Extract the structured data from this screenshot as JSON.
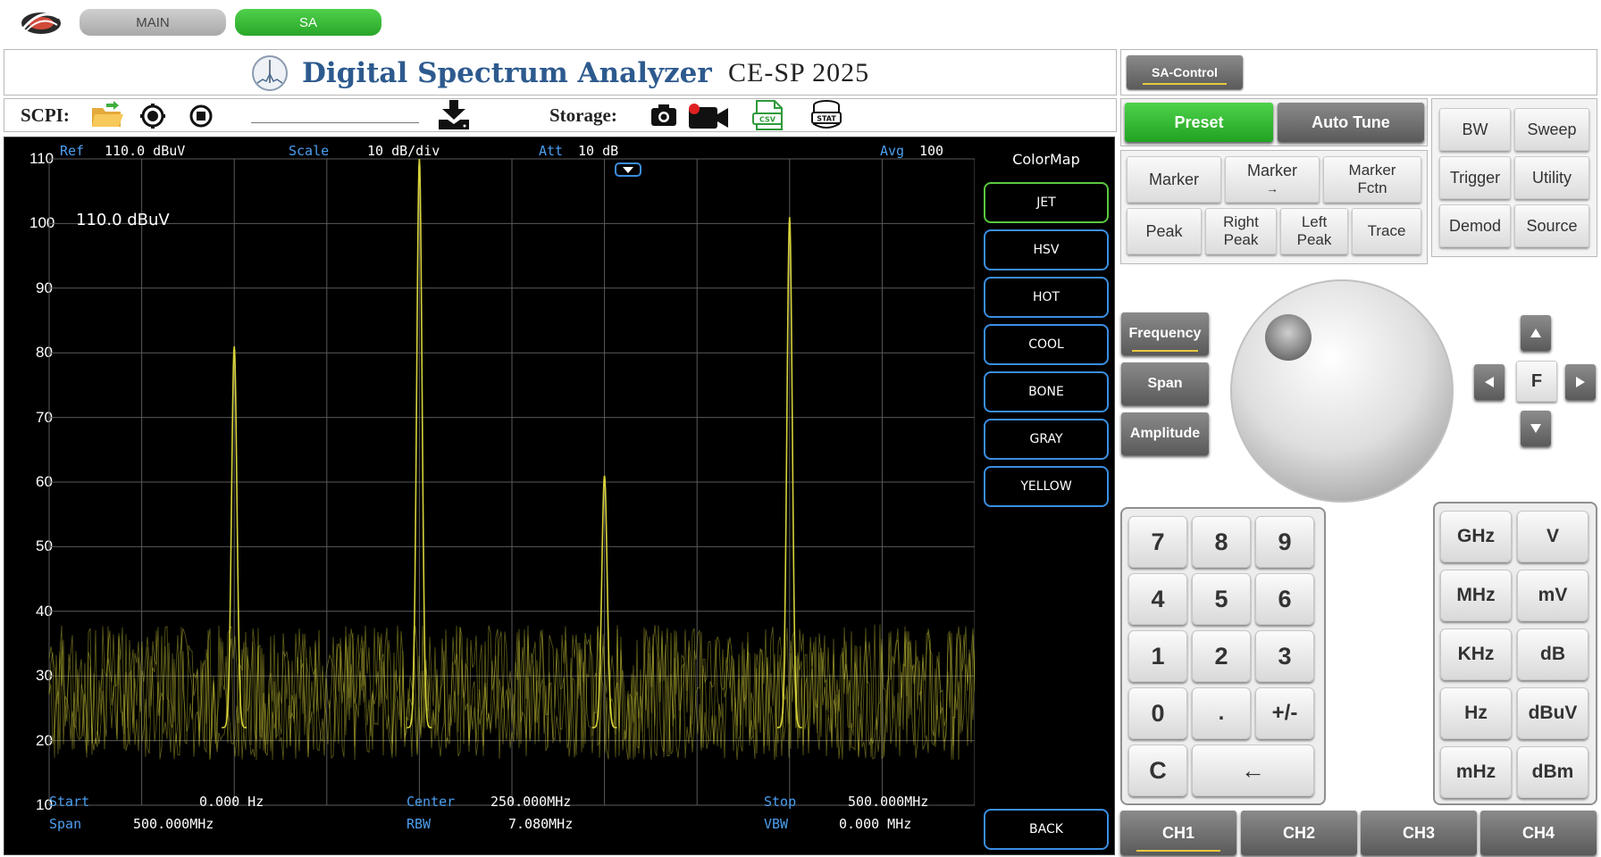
{
  "tabs": [
    {
      "label": "MAIN",
      "active": false
    },
    {
      "label": "SA",
      "active": true
    }
  ],
  "title": {
    "main": "Digital Spectrum Analyzer",
    "sub": "CE-SP  2025"
  },
  "toolbar": {
    "scpi_label": "SCPI:",
    "storage_label": "Storage:",
    "csv_text": "CSV",
    "stat_text": "STAT"
  },
  "sa_control": {
    "label": "SA-Control"
  },
  "scope": {
    "ref_label": "Ref",
    "ref_value": "110.0 dBuV",
    "scale_label": "Scale",
    "scale_value": "10 dB/div",
    "att_label": "Att",
    "att_value": "10 dB",
    "avg_label": "Avg",
    "avg_value": "100",
    "ref_overlay": "110.0 dBuV",
    "start_label": "Start",
    "start_value": "0.000 Hz",
    "center_label": "Center",
    "center_value": "250.000MHz",
    "stop_label": "Stop",
    "stop_value": "500.000MHz",
    "span_label": "Span",
    "span_value": "500.000MHz",
    "rbw_label": "RBW",
    "rbw_value": "7.080MHz",
    "vbw_label": "VBW",
    "vbw_value": "0.000 MHz",
    "trace_color": "#d6d23a"
  },
  "chart_data": {
    "type": "line",
    "xlim": [
      0,
      500
    ],
    "ylim": [
      10,
      110
    ],
    "yticks": [
      "110",
      "100",
      "90",
      "80",
      "70",
      "60",
      "50",
      "40",
      "30",
      "20",
      "10"
    ],
    "noise_floor": [
      17,
      38
    ],
    "series": [
      {
        "values": [
          {
            "x": 100,
            "y": 81
          },
          {
            "x": 200,
            "y": 110
          },
          {
            "x": 300,
            "y": 61
          },
          {
            "x": 400,
            "y": 101
          }
        ]
      }
    ]
  },
  "colormap": {
    "title": "ColorMap",
    "items": [
      "JET",
      "HSV",
      "HOT",
      "COOL",
      "BONE",
      "GRAY",
      "YELLOW"
    ],
    "active": "JET",
    "back_label": "BACK"
  },
  "controls": {
    "preset": "Preset",
    "auto_tune": "Auto Tune",
    "marker": "Marker",
    "marker_to": "Marker",
    "marker_to_arrow": "→",
    "marker_fctn_1": "Marker",
    "marker_fctn_2": "Fctn",
    "peak": "Peak",
    "right_peak_1": "Right",
    "right_peak_2": "Peak",
    "left_peak_1": "Left",
    "left_peak_2": "Peak",
    "trace": "Trace",
    "bw": "BW",
    "sweep": "Sweep",
    "trigger": "Trigger",
    "utility": "Utility",
    "demod": "Demod",
    "source": "Source",
    "frequency": "Frequency",
    "span": "Span",
    "amplitude": "Amplitude",
    "f": "F"
  },
  "keypad": [
    "7",
    "8",
    "9",
    "4",
    "5",
    "6",
    "1",
    "2",
    "3",
    "0",
    ".",
    "+/-"
  ],
  "keypad_clear": "C",
  "keypad_back": "←",
  "units": [
    "GHz",
    "V",
    "MHz",
    "mV",
    "KHz",
    "dB",
    "Hz",
    "dBuV",
    "mHz",
    "dBm"
  ],
  "channels": [
    "CH1",
    "CH2",
    "CH3",
    "CH4"
  ]
}
